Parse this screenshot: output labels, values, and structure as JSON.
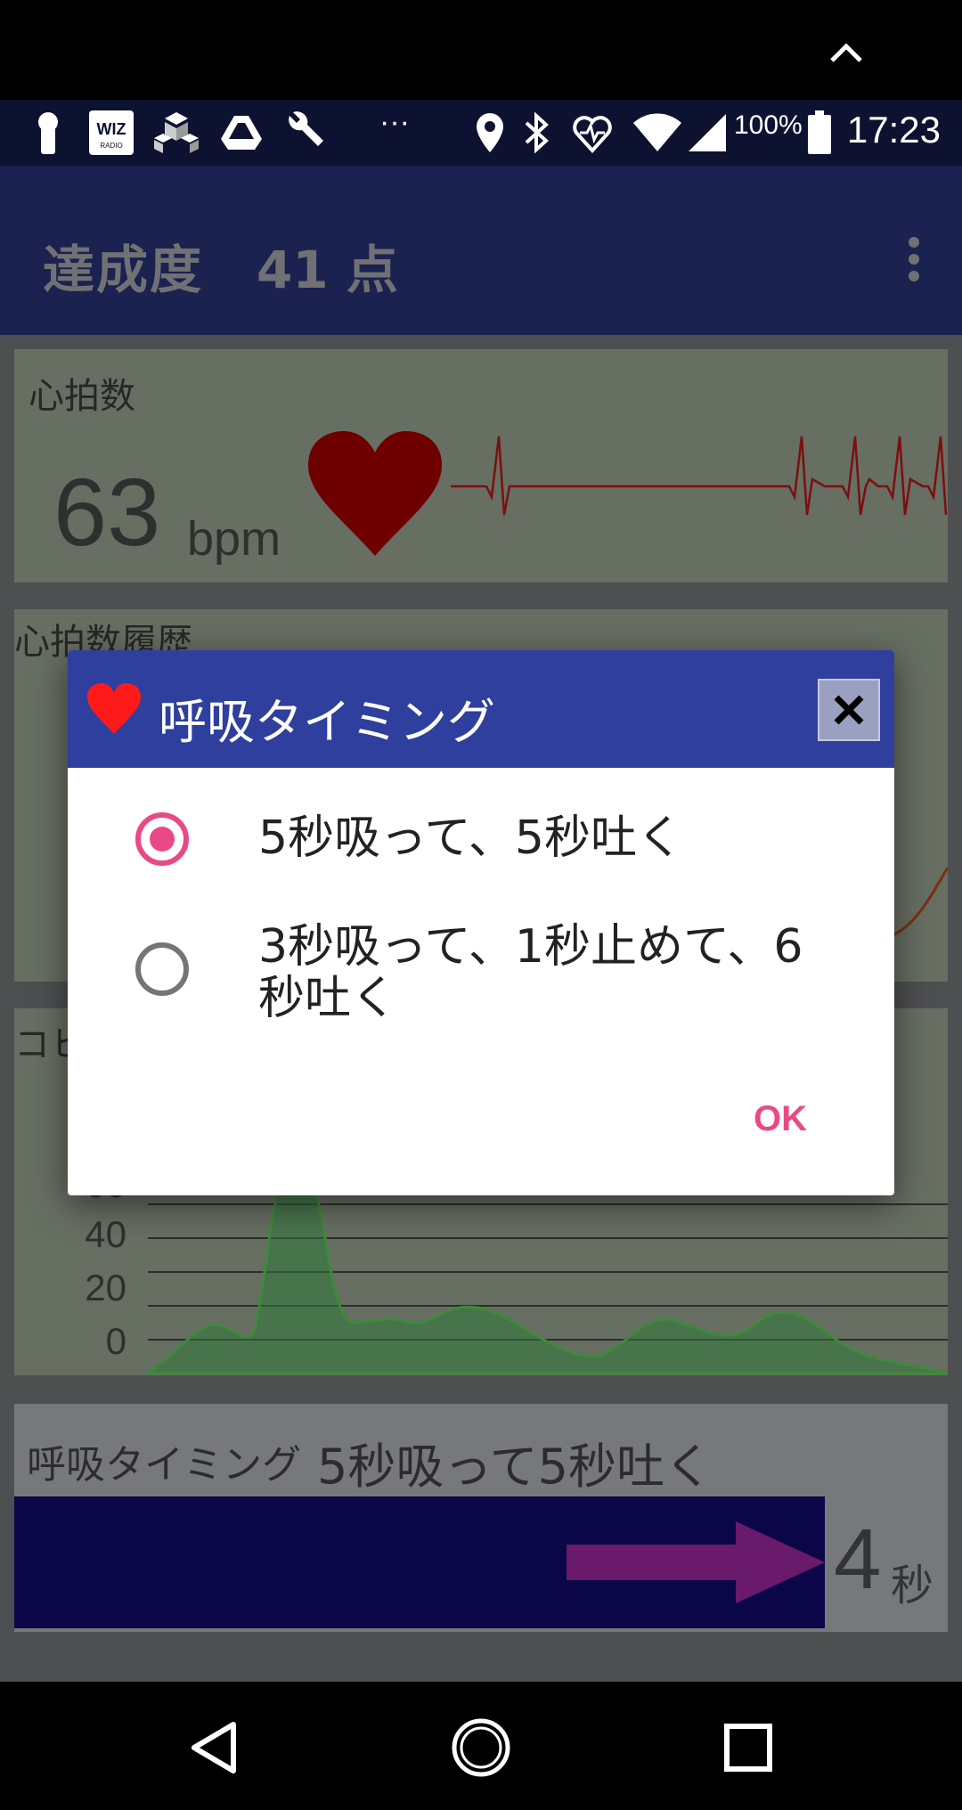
{
  "status_bar": {
    "battery_percent": "100%",
    "time": "17:23",
    "more_indicator": "···",
    "wiz_badge": "WIZ",
    "wiz_sub": "RADIO"
  },
  "app_bar": {
    "title": "達成度",
    "score": "41 点"
  },
  "heart_rate_card": {
    "label": "心拍数",
    "value": "63",
    "unit": "bpm"
  },
  "history_card": {
    "label": "心拍数履歴"
  },
  "coherence_card": {
    "label_partial": "コヒ",
    "ticks": [
      "60",
      "40",
      "20",
      "0"
    ]
  },
  "breathing_card": {
    "label": "呼吸タイミング",
    "mode": "5秒吸って5秒吐く",
    "seconds": "4",
    "seconds_unit": "秒"
  },
  "dialog": {
    "title": "呼吸タイミング",
    "options": [
      {
        "label": "5秒吸って、5秒吐く",
        "selected": true
      },
      {
        "label": "3秒吸って、1秒止めて、6秒吐く",
        "selected": false
      }
    ],
    "ok_label": "OK"
  },
  "colors": {
    "dialog_header": "#2f3f9e",
    "accent": "#e94a86",
    "heart": "#ff1a1a",
    "app_bar": "#1b2250",
    "breath_bar": "#0a0648",
    "arrow": "#6a1a6a"
  },
  "icons": {
    "status_bar": [
      "key-icon",
      "wiz-radio-icon",
      "cubes-icon",
      "drive-icon",
      "wrench-icon",
      "location-icon",
      "bluetooth-icon",
      "heart-monitor-icon",
      "wifi-icon",
      "cellular-icon",
      "battery-icon"
    ],
    "navigation": [
      "back-icon",
      "home-icon",
      "recents-icon"
    ]
  }
}
